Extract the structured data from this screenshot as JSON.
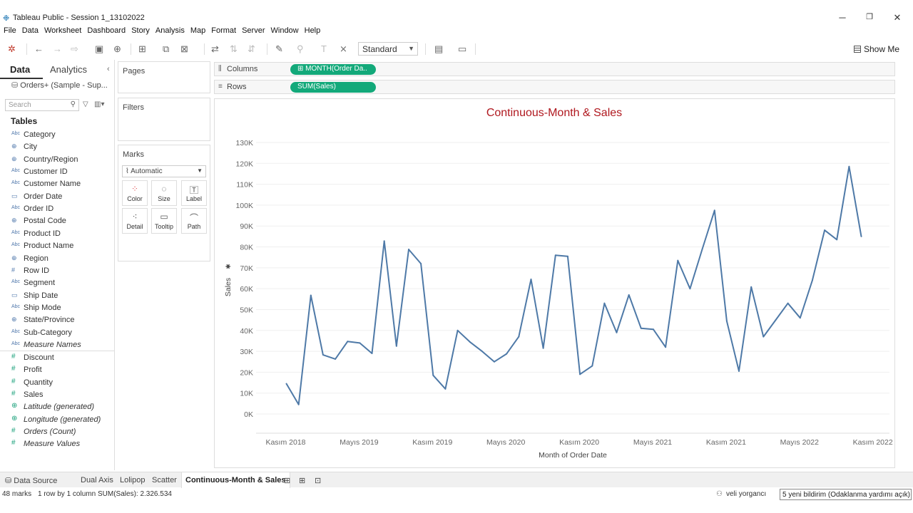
{
  "window": {
    "title": "Tableau Public - Session 1_13102022",
    "minimize": "─",
    "restore": "❐",
    "close": "✕"
  },
  "menu": [
    "File",
    "Data",
    "Worksheet",
    "Dashboard",
    "Story",
    "Analysis",
    "Map",
    "Format",
    "Server",
    "Window",
    "Help"
  ],
  "toolbar": {
    "fit_select": "Standard",
    "show_me": "Show Me"
  },
  "left_panel": {
    "tab_data": "Data",
    "tab_analytics": "Analytics",
    "datasource": "Orders+ (Sample - Sup...",
    "search_placeholder": "Search",
    "tables_header": "Tables",
    "dimensions": [
      {
        "icon": "Abc",
        "name": "Category",
        "kind": "string"
      },
      {
        "icon": "⊕",
        "name": "City",
        "kind": "geo"
      },
      {
        "icon": "⊕",
        "name": "Country/Region",
        "kind": "geo"
      },
      {
        "icon": "Abc",
        "name": "Customer ID",
        "kind": "string"
      },
      {
        "icon": "Abc",
        "name": "Customer Name",
        "kind": "string"
      },
      {
        "icon": "▭",
        "name": "Order Date",
        "kind": "date"
      },
      {
        "icon": "Abc",
        "name": "Order ID",
        "kind": "string"
      },
      {
        "icon": "⊕",
        "name": "Postal Code",
        "kind": "geo"
      },
      {
        "icon": "Abc",
        "name": "Product ID",
        "kind": "string"
      },
      {
        "icon": "Abc",
        "name": "Product Name",
        "kind": "string"
      },
      {
        "icon": "⊕",
        "name": "Region",
        "kind": "geo"
      },
      {
        "icon": "#",
        "name": "Row ID",
        "kind": "number"
      },
      {
        "icon": "Abc",
        "name": "Segment",
        "kind": "string"
      },
      {
        "icon": "▭",
        "name": "Ship Date",
        "kind": "date"
      },
      {
        "icon": "Abc",
        "name": "Ship Mode",
        "kind": "string"
      },
      {
        "icon": "⊕",
        "name": "State/Province",
        "kind": "geo"
      },
      {
        "icon": "Abc",
        "name": "Sub-Category",
        "kind": "string"
      },
      {
        "icon": "Abc",
        "name": "Measure Names",
        "kind": "string",
        "italic": true
      }
    ],
    "measures": [
      {
        "icon": "#",
        "name": "Discount"
      },
      {
        "icon": "#",
        "name": "Profit"
      },
      {
        "icon": "#",
        "name": "Quantity"
      },
      {
        "icon": "#",
        "name": "Sales"
      },
      {
        "icon": "⊕",
        "name": "Latitude (generated)",
        "italic": true
      },
      {
        "icon": "⊕",
        "name": "Longitude (generated)",
        "italic": true
      },
      {
        "icon": "#",
        "name": "Orders (Count)",
        "italic": true
      },
      {
        "icon": "#",
        "name": "Measure Values",
        "italic": true
      }
    ]
  },
  "cards": {
    "pages": "Pages",
    "filters": "Filters",
    "marks": "Marks",
    "marks_type": "Automatic",
    "mark_buttons": [
      {
        "label": "Color",
        "icon": "color-icon"
      },
      {
        "label": "Size",
        "icon": "size-icon"
      },
      {
        "label": "Label",
        "icon": "label-icon"
      },
      {
        "label": "Detail",
        "icon": "detail-icon"
      },
      {
        "label": "Tooltip",
        "icon": "tooltip-icon"
      },
      {
        "label": "Path",
        "icon": "path-icon"
      }
    ]
  },
  "shelves": {
    "columns_label": "Columns",
    "columns_pill": "⊞ MONTH(Order Da..",
    "rows_label": "Rows",
    "rows_pill": "SUM(Sales)"
  },
  "chart_data": {
    "type": "line",
    "title": "Continuous-Month & Sales",
    "xlabel": "Month of Order Date",
    "ylabel": "Sales",
    "ylim": [
      0,
      130000
    ],
    "yticks": [
      "0K",
      "10K",
      "20K",
      "30K",
      "40K",
      "50K",
      "60K",
      "70K",
      "80K",
      "90K",
      "100K",
      "110K",
      "120K",
      "130K"
    ],
    "xticks": [
      "Kasım 2018",
      "Mayıs 2019",
      "Kasım 2019",
      "Mayıs 2020",
      "Kasım 2020",
      "Mayıs 2021",
      "Kasım 2021",
      "Mayıs 2022",
      "Kasım 2022"
    ],
    "color": "#4e79a7",
    "grid": true,
    "series": [
      {
        "values": [
          14500,
          4500,
          56800,
          28300,
          26300,
          34700,
          34000,
          29000,
          82800,
          32500,
          78800,
          72000,
          18500,
          12000,
          40000,
          34500,
          30000,
          25000,
          28800,
          37000,
          64500,
          31500,
          76000,
          75500,
          19000,
          23000,
          53000,
          39000,
          57000,
          41000,
          40500,
          32000,
          73500,
          60000,
          79000,
          97500,
          44500,
          20500,
          60800,
          37000,
          45000,
          53000,
          46000,
          64000,
          88000,
          83500,
          118500,
          85000
        ]
      }
    ]
  },
  "bottom_tabs": [
    "Data Source",
    "Dual Axis",
    "Lolipop",
    "Scatter",
    "Continuous-Month & Sales"
  ],
  "status": {
    "marks": "48 marks",
    "rows_cols": "1 row by 1 column",
    "sum": "SUM(Sales): 2.326.534",
    "user": "veli yorgancı",
    "notification": "5 yeni bildirim (Odaklanma yardımı açık)"
  }
}
